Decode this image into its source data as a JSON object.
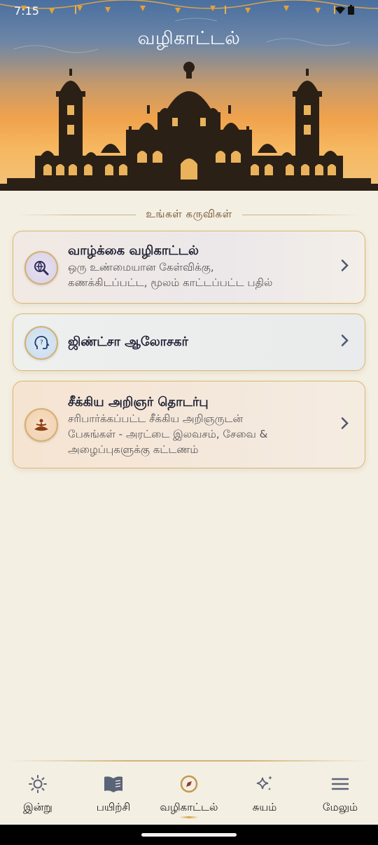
{
  "status_bar": {
    "time": "7:15",
    "icons": [
      "wifi-icon",
      "signal-icon",
      "battery-icon"
    ]
  },
  "header": {
    "title": "வழிகாட்டல்"
  },
  "section": {
    "title": "உங்கள் கருவிகள்"
  },
  "cards": [
    {
      "title": "வாழ்க்கை வழிகாட்டல்",
      "desc_line1": "ஒரு உண்மையான கேள்விக்கு,",
      "desc_line2": "கணக்கிடப்பட்ட, மூலம் காட்டப்பட்ட பதில்",
      "icon": "search-globe-icon"
    },
    {
      "title": "ஜிண்ட்சா ஆலோசகர்",
      "icon": "head-question-icon"
    },
    {
      "title": "சீக்கிய அறிஞர் தொடர்பு",
      "desc_line1": "சரிபார்க்கப்பட்ட சீக்கிய அறிஞருடன்",
      "desc_line2": "பேசுங்கள் - அரட்டை இலவசம், சேவை &",
      "desc_line3": "அழைப்புகளுக்கு கட்டணம்",
      "icon": "meditation-icon"
    }
  ],
  "nav": [
    {
      "label": "இன்று",
      "icon": "sun-icon"
    },
    {
      "label": "பயிற்சி",
      "icon": "book-icon"
    },
    {
      "label": "வழிகாட்டல்",
      "icon": "compass-icon",
      "active": true
    },
    {
      "label": "சுயம்",
      "icon": "sparkle-icon"
    },
    {
      "label": "மேலும்",
      "icon": "menu-icon"
    }
  ],
  "colors": {
    "accent_gold": "#d8b770",
    "background": "#f4efe3",
    "text_dark": "#1f2335"
  }
}
